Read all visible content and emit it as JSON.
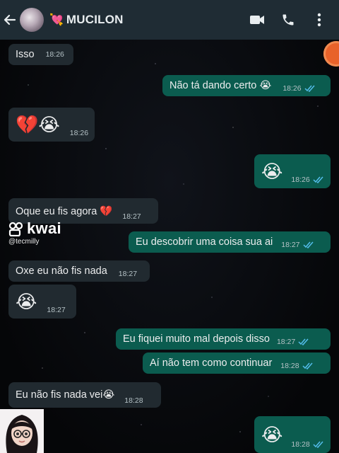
{
  "header": {
    "contact_name": "MUCILON",
    "name_emoji": "💘",
    "back_icon": "arrow-left-icon",
    "icons": [
      "video-call-icon",
      "voice-call-icon",
      "more-options-icon"
    ],
    "bar_color": "#1f2c34"
  },
  "watermark": {
    "brand": "kwai",
    "user": "@tecmilly"
  },
  "colors": {
    "incoming_bubble": "#212a30",
    "outgoing_bubble": "#0b5c4f",
    "read_ticks": "#53bdeb"
  },
  "messages": [
    {
      "dir": "in",
      "text": "Isso",
      "time": "18:26"
    },
    {
      "dir": "out",
      "text": "Não tá dando certo 😭",
      "time": "18:26"
    },
    {
      "dir": "in",
      "text": "💔😭",
      "time": "18:26"
    },
    {
      "dir": "out",
      "text": "😭",
      "time": "18:26"
    },
    {
      "dir": "in",
      "text": "Oque eu fis agora 💔",
      "time": "18:27"
    },
    {
      "dir": "out",
      "text": "Eu descobrir uma coisa sua ai",
      "time": "18:27"
    },
    {
      "dir": "in",
      "text": "Oxe eu não fis nada",
      "time": "18:27"
    },
    {
      "dir": "in",
      "text": "😭",
      "time": "18:27"
    },
    {
      "dir": "out",
      "text": "Eu fiquei muito mal depois disso",
      "time": "18:27"
    },
    {
      "dir": "out",
      "text": "Aí não tem como continuar",
      "time": "18:28"
    },
    {
      "dir": "in",
      "text": "Eu não fis nada vei😭",
      "time": "18:28"
    },
    {
      "dir": "out",
      "text": "😭",
      "time": "18:28"
    }
  ]
}
